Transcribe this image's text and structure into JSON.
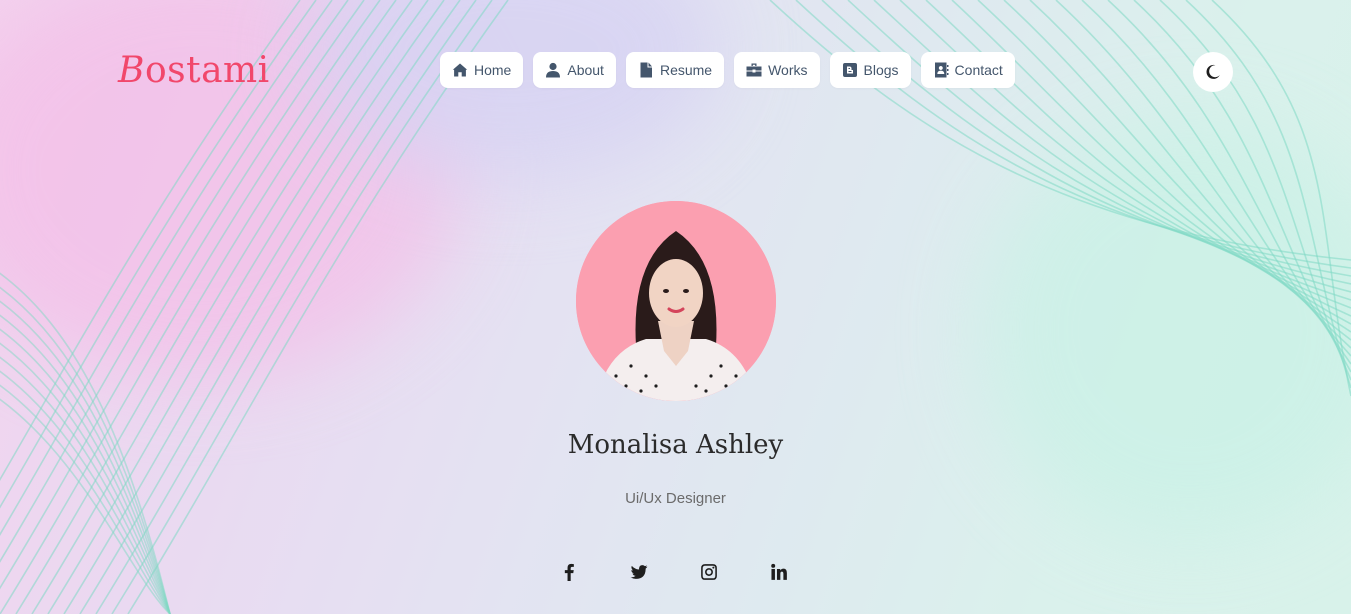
{
  "brand": {
    "logo_first": "B",
    "logo_rest": "ostami",
    "color": "#f1476b"
  },
  "nav": {
    "items": [
      {
        "label": "Home",
        "icon": "home-icon"
      },
      {
        "label": "About",
        "icon": "user-icon"
      },
      {
        "label": "Resume",
        "icon": "file-icon"
      },
      {
        "label": "Works",
        "icon": "briefcase-icon"
      },
      {
        "label": "Blogs",
        "icon": "blogger-icon"
      },
      {
        "label": "Contact",
        "icon": "address-book-icon"
      }
    ]
  },
  "theme_toggle": {
    "icon": "moon-icon"
  },
  "profile": {
    "name": "Monalisa Ashley",
    "role": "Ui/Ux Designer"
  },
  "socials": [
    {
      "icon": "facebook-icon"
    },
    {
      "icon": "twitter-icon"
    },
    {
      "icon": "instagram-icon"
    },
    {
      "icon": "linkedin-icon"
    }
  ],
  "colors": {
    "accent": "#f1476b",
    "line": "#7fd9c4",
    "avatar_bg": "#fb9fb0"
  }
}
